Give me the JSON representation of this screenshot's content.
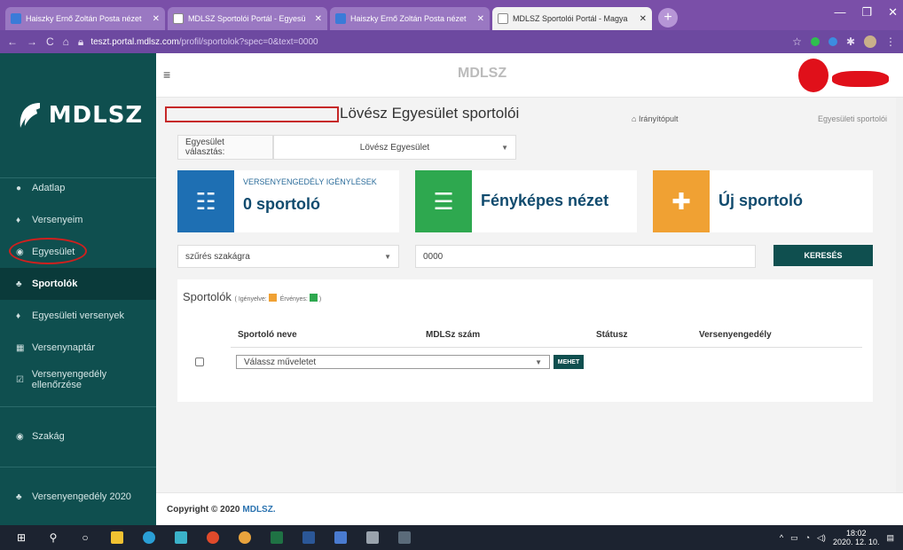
{
  "browser": {
    "tabs": [
      {
        "title": "Haiszky Ernő Zoltán Posta nézet",
        "active": false
      },
      {
        "title": "MDLSZ Sportolói Portál - Egyesü",
        "active": false
      },
      {
        "title": "Haiszky Ernő Zoltán Posta nézet",
        "active": false
      },
      {
        "title": "MDLSZ Sportolói Portál - Magya",
        "active": true
      }
    ],
    "url_host": "teszt.portal.mdlsz.com",
    "url_path": "/profil/sportolok?spec=0&text=0000"
  },
  "sidebar": {
    "logo": "MDLSZ",
    "items": [
      {
        "label": "Adatlap",
        "icon": "user-icon"
      },
      {
        "label": "Versenyeim",
        "icon": "trophy-icon"
      },
      {
        "label": "Egyesület",
        "icon": "circle-icon"
      },
      {
        "label": "Sportolók",
        "icon": "users-icon"
      },
      {
        "label": "Egyesületi versenyek",
        "icon": "trophy-icon"
      },
      {
        "label": "Versenynaptár",
        "icon": "calendar-icon"
      },
      {
        "label": "Versenyengedély ellenőrzése",
        "icon": "check-square-icon"
      },
      {
        "label": "Szakág",
        "icon": "circle-icon"
      },
      {
        "label": "Versenyengedély 2020",
        "icon": "users-icon"
      }
    ]
  },
  "topbar": {
    "logo": "MDLSZ"
  },
  "page": {
    "title": "Lövész Egyesület sportolói",
    "breadcrumb_home": "Irányítópult",
    "breadcrumb_current": "Egyesületi sportolói"
  },
  "club_select": {
    "label": "Egyesület választás:",
    "value": "Lövész Egyesület"
  },
  "cards": {
    "requests_small": "VERSENYENGEDÉLY IGÉNYLÉSEK",
    "requests_big": "0 sportoló",
    "photo_view": "Fényképes nézet",
    "new_athlete": "Új sportoló"
  },
  "filter": {
    "discipline": "szűrés szakágra",
    "search_text": "0000",
    "search_button": "KERESÉS"
  },
  "panel": {
    "title": "Sportolók",
    "legend_requested": "Igényelve:",
    "legend_valid": "Érvényes:",
    "columns": [
      "Sportoló neve",
      "MDLSz szám",
      "Státusz",
      "Versenyengedély"
    ],
    "action_select": "Válassz műveletet",
    "go_button": "MEHET"
  },
  "footer": {
    "copyright": "Copyright © 2020",
    "brand": "MDLSZ."
  },
  "taskbar": {
    "time": "18:02",
    "date": "2020. 12. 10."
  },
  "colors": {
    "sidebar": "#0f4f4f",
    "blue": "#1e6fb3",
    "green": "#2ea84f",
    "orange": "#f0a133"
  }
}
